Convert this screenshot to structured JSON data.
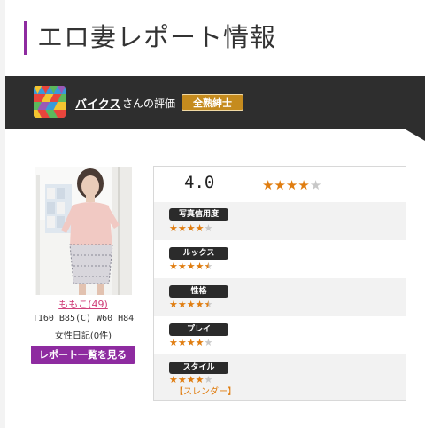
{
  "page_title": "エロ妻レポート情報",
  "reviewer": {
    "name": "バイクス",
    "suffix": "さんの評価",
    "rank_badge": "全熟紳士"
  },
  "profile": {
    "name": "ももこ(49)",
    "stats": "T160 B85(C) W60 H84",
    "diary": "女性日記(0件)",
    "report_list_button": "レポート一覧を見る"
  },
  "ratings": {
    "overall": {
      "score": "4.0",
      "stars": 4
    },
    "categories": [
      {
        "label": "写真信用度",
        "stars": 4
      },
      {
        "label": "ルックス",
        "stars": 4.5
      },
      {
        "label": "性格",
        "stars": 4.5
      },
      {
        "label": "プレイ",
        "stars": 4
      },
      {
        "label": "スタイル",
        "stars": 4,
        "note": "【スレンダー】"
      }
    ]
  },
  "colors": {
    "accent_purple": "#8e2ba0",
    "band_dark": "#2e2e2e",
    "badge_gold": "#c58b1e",
    "star_orange": "#e07d10"
  }
}
